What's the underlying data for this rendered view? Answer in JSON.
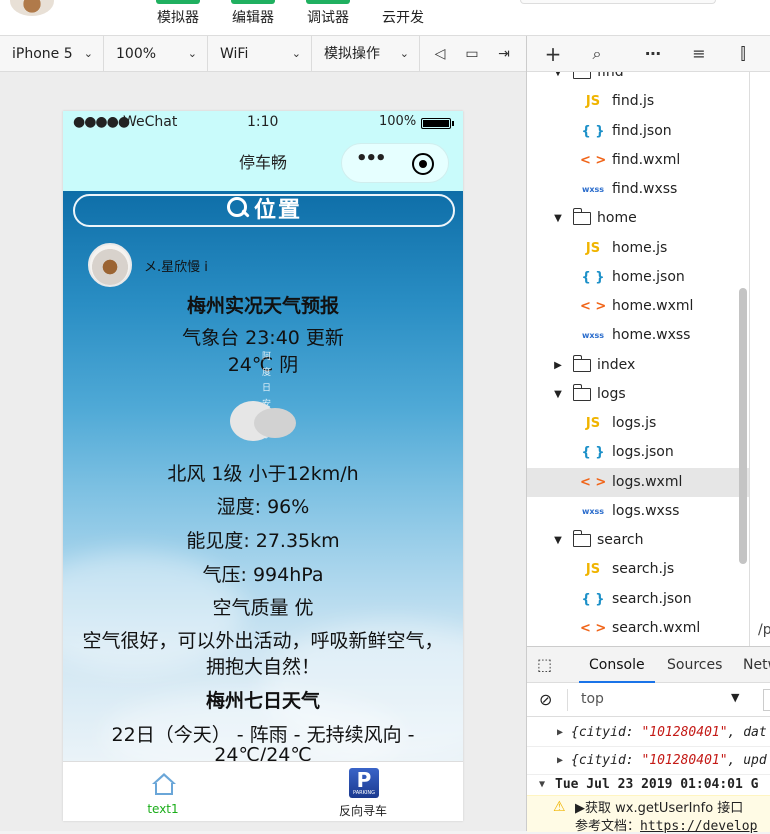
{
  "toolbar": {
    "buttons": [
      "模拟器",
      "编辑器",
      "调试器",
      "云开发"
    ]
  },
  "device_bar": {
    "device": "iPhone 5",
    "zoom": "100%",
    "network": "WiFi",
    "operate": "模拟操作"
  },
  "phone": {
    "status": {
      "signal": "●●●●●",
      "carrier": "WeChat",
      "time": "1:10",
      "battery": "100%"
    },
    "nav_title": "停车畅",
    "capsule_more": "•••",
    "search_label": "位置",
    "user_name": "メ.星欣慢 i",
    "lines": [
      "梅州实况天气预报",
      "气象台 23:40 更新",
      "24℃ 阴",
      "北风 1级 小于12km/h",
      "湿度: 96%",
      "能见度: 27.35km",
      "气压: 994hPa",
      "空气质量 优",
      "空气很好，可以外出活动，呼吸新鲜空气，",
      "拥抱大自然！",
      "梅州七日天气",
      "22日（今天） - 阵雨 - 无持续风向 -",
      "24℃/24℃"
    ],
    "deco_text": "阿 度 日 安 上 か",
    "tabs": [
      {
        "label": "text1",
        "icon": "home-icon",
        "color": "#1aad19"
      },
      {
        "label": "反向寻车",
        "icon": "parking-icon",
        "badge": "P",
        "badge_sub": "PARKING"
      }
    ]
  },
  "tree": {
    "items": [
      {
        "type": "folder",
        "name": "find",
        "open": true
      },
      {
        "type": "js",
        "name": "find.js",
        "tag": "JS"
      },
      {
        "type": "json",
        "name": "find.json",
        "tag": "{ }"
      },
      {
        "type": "wxml",
        "name": "find.wxml",
        "tag": "< >"
      },
      {
        "type": "wxss",
        "name": "find.wxss",
        "tag": "wxss"
      },
      {
        "type": "folder",
        "name": "home",
        "open": true
      },
      {
        "type": "js",
        "name": "home.js",
        "tag": "JS"
      },
      {
        "type": "json",
        "name": "home.json",
        "tag": "{ }"
      },
      {
        "type": "wxml",
        "name": "home.wxml",
        "tag": "< >"
      },
      {
        "type": "wxss",
        "name": "home.wxss",
        "tag": "wxss"
      },
      {
        "type": "folder",
        "name": "index",
        "open": false
      },
      {
        "type": "folder",
        "name": "logs",
        "open": true
      },
      {
        "type": "js",
        "name": "logs.js",
        "tag": "JS"
      },
      {
        "type": "json",
        "name": "logs.json",
        "tag": "{ }"
      },
      {
        "type": "wxml",
        "name": "logs.wxml",
        "tag": "< >",
        "selected": true
      },
      {
        "type": "wxss",
        "name": "logs.wxss",
        "tag": "wxss"
      },
      {
        "type": "folder",
        "name": "search",
        "open": true
      },
      {
        "type": "js",
        "name": "search.js",
        "tag": "JS"
      },
      {
        "type": "json",
        "name": "search.json",
        "tag": "{ }"
      },
      {
        "type": "wxml",
        "name": "search.wxml",
        "tag": "< >"
      }
    ],
    "editor_edge": "/p"
  },
  "devtools": {
    "tabs": [
      "Console",
      "Sources",
      "Netw"
    ],
    "active_tab": "Console",
    "filter": "top",
    "messages": [
      {
        "prefix": "{cityid: ",
        "value": "\"101280401\"",
        "suffix": ", dat"
      },
      {
        "prefix": "{cityid: ",
        "value": "\"101280401\"",
        "suffix": ", upd"
      },
      {
        "prefix": "Tue Jul 23 2019 01:04:01 G",
        "value": "",
        "suffix": ""
      }
    ],
    "warning_line1": "▶获取 wx.getUserInfo 接口",
    "warning_line2_prefix": "参考文档：",
    "warning_line2_link": "https://develop"
  }
}
